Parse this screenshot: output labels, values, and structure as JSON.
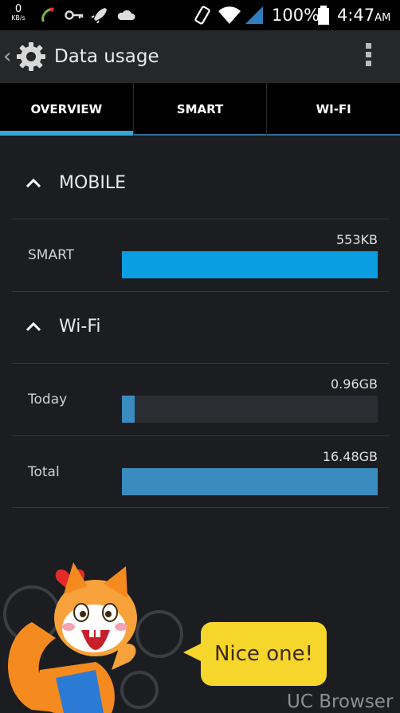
{
  "status_bar": {
    "net_speed_value": "0",
    "net_speed_unit": "KB/s",
    "icons": [
      "phone-missed-icon",
      "key-icon",
      "rocket-icon",
      "cloud-icon",
      "vibrate-icon",
      "wifi-icon",
      "signal-icon",
      "battery-icon"
    ],
    "battery": "100%",
    "time": "4:47",
    "ampm": "AM"
  },
  "action_bar": {
    "title": "Data usage"
  },
  "tabs": [
    {
      "label": "OVERVIEW",
      "active": true
    },
    {
      "label": "SMART",
      "active": false
    },
    {
      "label": "WI-FI",
      "active": false
    }
  ],
  "sections": {
    "mobile": {
      "title": "MOBILE",
      "rows": [
        {
          "label": "SMART",
          "value": "553KB",
          "fill": 1.0,
          "color": "#0a9ee0"
        }
      ]
    },
    "wifi": {
      "title": "Wi-Fi",
      "rows": [
        {
          "label": "Today",
          "value": "0.96GB",
          "fill": 0.05,
          "color": "#3a8bbf"
        },
        {
          "label": "Total",
          "value": "16.48GB",
          "fill": 1.0,
          "color": "#3a8bbf"
        }
      ]
    }
  },
  "promo": {
    "bubble_text": "Nice one!",
    "brand": "UC Browser"
  },
  "colors": {
    "accent": "#34a6d8",
    "mobile_bar": "#0a9ee0",
    "wifi_bar": "#3a8bbf",
    "bubble": "#f7d62c"
  }
}
